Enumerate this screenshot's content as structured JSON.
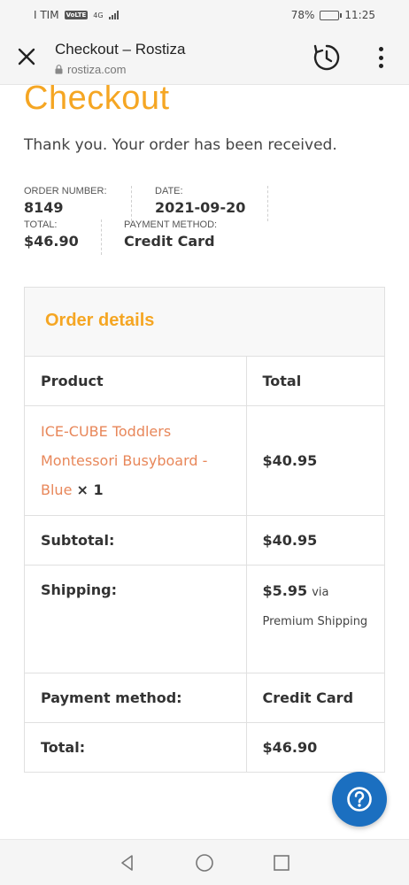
{
  "status_bar": {
    "carrier": "I TIM",
    "volte": "VoLTE",
    "network": "4G",
    "battery": "78%",
    "battery_level": 0.78,
    "time": "11:25"
  },
  "browser": {
    "title": "Checkout – Rostiza",
    "url": "rostiza.com"
  },
  "page": {
    "title": "Checkout",
    "thank_you": "Thank you. Your order has been received."
  },
  "overview": {
    "order_number_label": "ORDER NUMBER:",
    "order_number": "8149",
    "date_label": "DATE:",
    "date": "2021-09-20",
    "total_label": "TOTAL:",
    "total": "$46.90",
    "payment_label": "PAYMENT METHOD:",
    "payment": "Credit Card"
  },
  "order_details": {
    "title": "Order details",
    "headers": {
      "product": "Product",
      "total": "Total"
    },
    "item": {
      "name": "ICE-CUBE Toddlers Montessori Busyboard - Blue",
      "qty": "× 1",
      "amount": "$40.95"
    },
    "subtotal": {
      "label": "Subtotal:",
      "value": "$40.95"
    },
    "shipping": {
      "label": "Shipping:",
      "value": "$5.95",
      "method": "via Premium Shipping"
    },
    "payment_method": {
      "label": "Payment method:",
      "value": "Credit Card"
    },
    "total": {
      "label": "Total:",
      "value": "$46.90"
    }
  },
  "colors": {
    "accent": "#f5a623",
    "link": "#e8875a",
    "fab": "#1b6fc0"
  },
  "icons": {
    "close": "close-icon",
    "lock": "lock-icon",
    "history": "history-icon",
    "menu": "more-vertical-icon",
    "help": "help-icon",
    "back": "back-icon",
    "home": "home-icon",
    "recents": "recents-icon"
  }
}
